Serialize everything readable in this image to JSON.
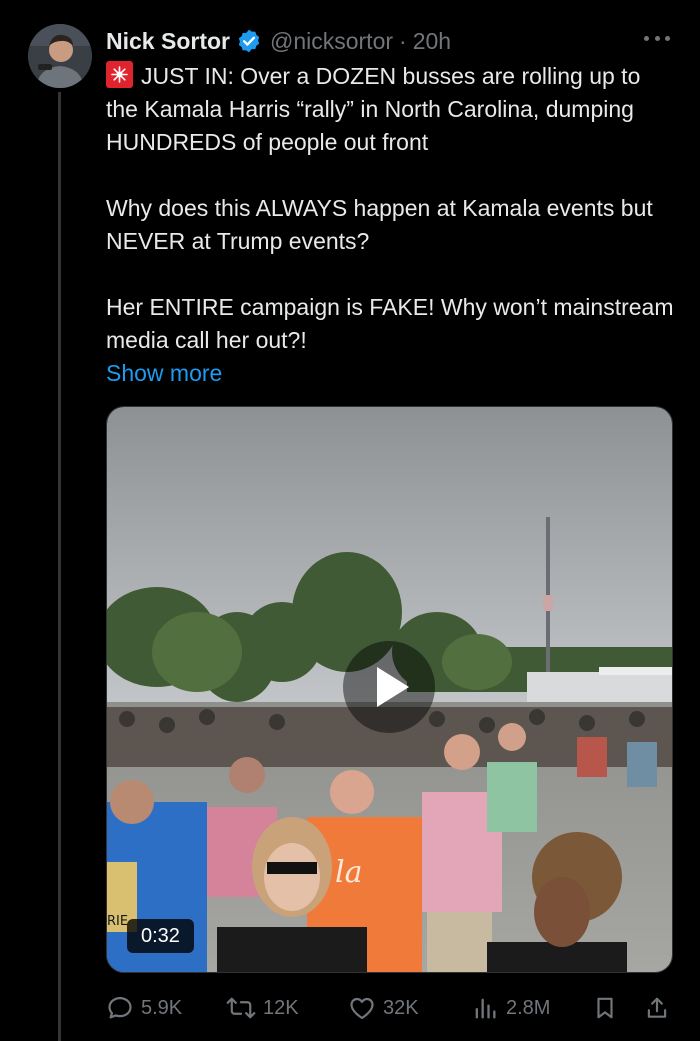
{
  "author": {
    "name": "Nick Sortor",
    "handle": "@nicksortor",
    "separator": "·",
    "time": "20h"
  },
  "post": {
    "line1": "JUST IN: Over a DOZEN busses are rolling up to the Kamala Harris “rally” in North Carolina, dumping HUNDREDS of people out front",
    "line2": "Why does this ALWAYS happen at Kamala events but NEVER at Trump events?",
    "line3": "Her ENTIRE campaign is FAKE! Why won’t mainstream media call her out?!",
    "show_more": "Show more",
    "siren_emoji": "rotating-light-icon"
  },
  "media": {
    "type": "video",
    "duration": "0:32",
    "shirt_text": "la",
    "sign_text": "RIE"
  },
  "actions": {
    "replies": "5.9K",
    "reposts": "12K",
    "likes": "32K",
    "views": "2.8M"
  },
  "colors": {
    "background": "#000000",
    "text": "#e7e9ea",
    "muted": "#71767b",
    "link": "#1d9bf0",
    "verified": "#1d9bf0"
  }
}
